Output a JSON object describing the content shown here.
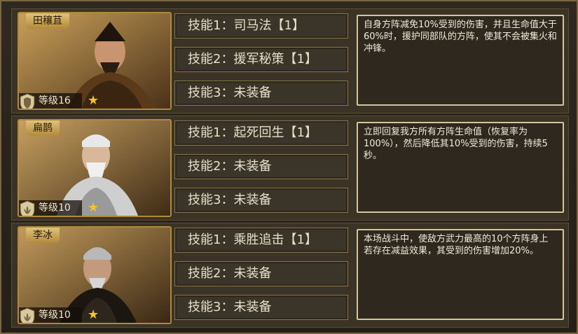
{
  "heroes": [
    {
      "name": "田穰苴",
      "level": "等级16",
      "skills": [
        "技能1：司马法【1】",
        "技能2：援军秘策【1】",
        "技能3：未装备"
      ],
      "description": "自身方阵减免10%受到的伤害，并且生命值大于60%时，援护同部队的方阵，使其不会被集火和冲锋。"
    },
    {
      "name": "扁鹊",
      "level": "等级10",
      "skills": [
        "技能1：起死回生【1】",
        "技能2：未装备",
        "技能3：未装备"
      ],
      "description": "立即回复我方所有方阵生命值（恢复率为100%），然后降低其10%受到的伤害，持续5秒。"
    },
    {
      "name": "李冰",
      "level": "等级10",
      "skills": [
        "技能1：乘胜追击【1】",
        "技能2：未装备",
        "技能3：未装备"
      ],
      "description": "本场战斗中，使敌方武力最高的10个方阵身上若存在减益效果，其受到的伤害增加20%。"
    }
  ],
  "colors": {
    "accent_gold": "#b08a3c",
    "star": "#f3c232",
    "text_light": "#e8dfca"
  }
}
